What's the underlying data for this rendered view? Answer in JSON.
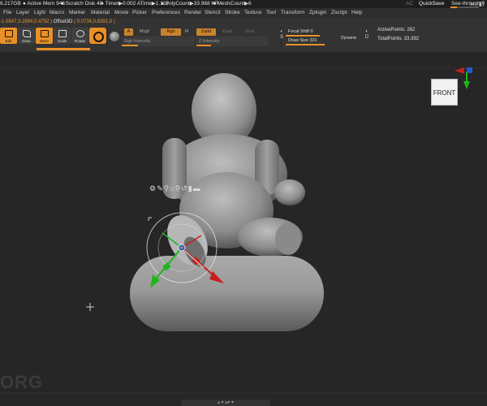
{
  "status_bar": {
    "memory": "6.217GB",
    "active_mem": "● Active Mem 946",
    "scratch_disk": "● Scratch Disk 48",
    "timer": "● Timer▶0.002 ATime▶1.113",
    "poly_count": "● PolyCount▶33.968 KP",
    "mesh_count": "● MeshCount▶6",
    "ac": "AC",
    "quicksave": "QuickSave",
    "see_through": "See-through  0",
    "window_controls": "⇲ ◧ ⊗"
  },
  "menu": [
    "File",
    "Layer",
    "Light",
    "Macro",
    "Marker",
    "Material",
    "Movie",
    "Picker",
    "Preferences",
    "Render",
    "Stencil",
    "Stroke",
    "Texture",
    "Tool",
    "Transform",
    "Zplugin",
    "Zscript",
    "Help"
  ],
  "coords": {
    "position": "-1.0547,3.2994,0.4752 )",
    "offset_label": "Offset3D",
    "offset_value": "( 0.0734,0.8391,0 )"
  },
  "toolbar": {
    "edit": "Edit",
    "draw": "Draw",
    "move": "Move",
    "scale": "Scale",
    "rotate": "Rotate",
    "a_label": "A",
    "mrgb": "Mrgb",
    "rgb": "Rgb",
    "m": "M",
    "zadd": "Zadd",
    "zsub": "Zsub",
    "zcut": "Zcut",
    "rgb_intensity": "Rgb Intensity",
    "z_intensity": "Z Intensity",
    "focal_shift": "Focal Shift 0",
    "draw_size": "Draw Size 331",
    "dynamic": "Dynamic",
    "active_points": "ActivePoints: 262",
    "total_points": "TotalPoints: 33,392"
  },
  "viewport": {
    "nav_cube_label": "FRONT",
    "watermark": "ORG",
    "bottom_strip": "▴ ▾ ▴▾ ▾"
  },
  "gizmo_toolbar": [
    "⚙",
    "✎",
    "⚲",
    "⌂",
    "⚲",
    "↺",
    "▮",
    "▬"
  ],
  "colors": {
    "accent": "#e8902a",
    "axis_x": "#c81e1e",
    "axis_y": "#1fb51f",
    "axis_z": "#1e5ad0"
  }
}
